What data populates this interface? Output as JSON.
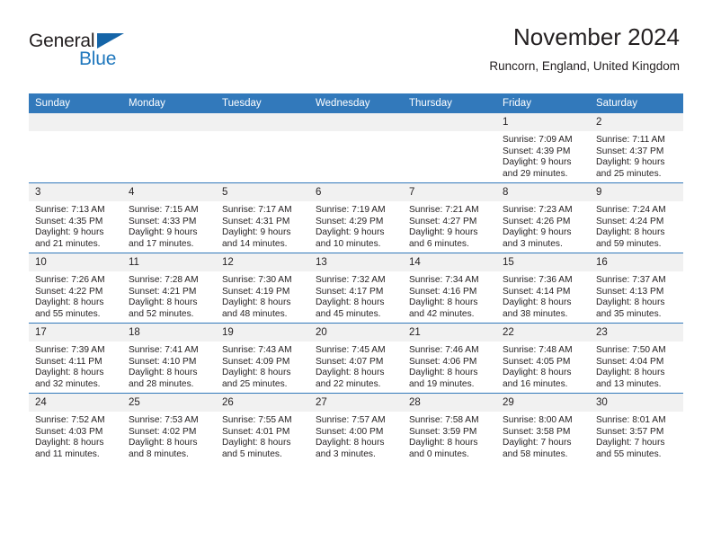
{
  "brand": {
    "name_primary": "General",
    "name_secondary": "Blue",
    "flag_icon": "triangle-flag-icon",
    "accent_color": "#1f77bd"
  },
  "header": {
    "title": "November 2024",
    "subtitle": "Runcorn, England, United Kingdom"
  },
  "theme": {
    "header_row_color": "#3279bb",
    "daynum_band_color": "#f1f1f1",
    "text_color": "#231f20"
  },
  "weekday_headers": [
    "Sunday",
    "Monday",
    "Tuesday",
    "Wednesday",
    "Thursday",
    "Friday",
    "Saturday"
  ],
  "labels": {
    "sunrise_prefix": "Sunrise:",
    "sunset_prefix": "Sunset:",
    "daylight_prefix": "Daylight:"
  },
  "weeks": [
    [
      {
        "day": "",
        "empty": true
      },
      {
        "day": "",
        "empty": true
      },
      {
        "day": "",
        "empty": true
      },
      {
        "day": "",
        "empty": true
      },
      {
        "day": "",
        "empty": true
      },
      {
        "day": "1",
        "sunrise": "Sunrise: 7:09 AM",
        "sunset": "Sunset: 4:39 PM",
        "daylight_line1": "Daylight: 9 hours",
        "daylight_line2": "and 29 minutes."
      },
      {
        "day": "2",
        "sunrise": "Sunrise: 7:11 AM",
        "sunset": "Sunset: 4:37 PM",
        "daylight_line1": "Daylight: 9 hours",
        "daylight_line2": "and 25 minutes."
      }
    ],
    [
      {
        "day": "3",
        "sunrise": "Sunrise: 7:13 AM",
        "sunset": "Sunset: 4:35 PM",
        "daylight_line1": "Daylight: 9 hours",
        "daylight_line2": "and 21 minutes."
      },
      {
        "day": "4",
        "sunrise": "Sunrise: 7:15 AM",
        "sunset": "Sunset: 4:33 PM",
        "daylight_line1": "Daylight: 9 hours",
        "daylight_line2": "and 17 minutes."
      },
      {
        "day": "5",
        "sunrise": "Sunrise: 7:17 AM",
        "sunset": "Sunset: 4:31 PM",
        "daylight_line1": "Daylight: 9 hours",
        "daylight_line2": "and 14 minutes."
      },
      {
        "day": "6",
        "sunrise": "Sunrise: 7:19 AM",
        "sunset": "Sunset: 4:29 PM",
        "daylight_line1": "Daylight: 9 hours",
        "daylight_line2": "and 10 minutes."
      },
      {
        "day": "7",
        "sunrise": "Sunrise: 7:21 AM",
        "sunset": "Sunset: 4:27 PM",
        "daylight_line1": "Daylight: 9 hours",
        "daylight_line2": "and 6 minutes."
      },
      {
        "day": "8",
        "sunrise": "Sunrise: 7:23 AM",
        "sunset": "Sunset: 4:26 PM",
        "daylight_line1": "Daylight: 9 hours",
        "daylight_line2": "and 3 minutes."
      },
      {
        "day": "9",
        "sunrise": "Sunrise: 7:24 AM",
        "sunset": "Sunset: 4:24 PM",
        "daylight_line1": "Daylight: 8 hours",
        "daylight_line2": "and 59 minutes."
      }
    ],
    [
      {
        "day": "10",
        "sunrise": "Sunrise: 7:26 AM",
        "sunset": "Sunset: 4:22 PM",
        "daylight_line1": "Daylight: 8 hours",
        "daylight_line2": "and 55 minutes."
      },
      {
        "day": "11",
        "sunrise": "Sunrise: 7:28 AM",
        "sunset": "Sunset: 4:21 PM",
        "daylight_line1": "Daylight: 8 hours",
        "daylight_line2": "and 52 minutes."
      },
      {
        "day": "12",
        "sunrise": "Sunrise: 7:30 AM",
        "sunset": "Sunset: 4:19 PM",
        "daylight_line1": "Daylight: 8 hours",
        "daylight_line2": "and 48 minutes."
      },
      {
        "day": "13",
        "sunrise": "Sunrise: 7:32 AM",
        "sunset": "Sunset: 4:17 PM",
        "daylight_line1": "Daylight: 8 hours",
        "daylight_line2": "and 45 minutes."
      },
      {
        "day": "14",
        "sunrise": "Sunrise: 7:34 AM",
        "sunset": "Sunset: 4:16 PM",
        "daylight_line1": "Daylight: 8 hours",
        "daylight_line2": "and 42 minutes."
      },
      {
        "day": "15",
        "sunrise": "Sunrise: 7:36 AM",
        "sunset": "Sunset: 4:14 PM",
        "daylight_line1": "Daylight: 8 hours",
        "daylight_line2": "and 38 minutes."
      },
      {
        "day": "16",
        "sunrise": "Sunrise: 7:37 AM",
        "sunset": "Sunset: 4:13 PM",
        "daylight_line1": "Daylight: 8 hours",
        "daylight_line2": "and 35 minutes."
      }
    ],
    [
      {
        "day": "17",
        "sunrise": "Sunrise: 7:39 AM",
        "sunset": "Sunset: 4:11 PM",
        "daylight_line1": "Daylight: 8 hours",
        "daylight_line2": "and 32 minutes."
      },
      {
        "day": "18",
        "sunrise": "Sunrise: 7:41 AM",
        "sunset": "Sunset: 4:10 PM",
        "daylight_line1": "Daylight: 8 hours",
        "daylight_line2": "and 28 minutes."
      },
      {
        "day": "19",
        "sunrise": "Sunrise: 7:43 AM",
        "sunset": "Sunset: 4:09 PM",
        "daylight_line1": "Daylight: 8 hours",
        "daylight_line2": "and 25 minutes."
      },
      {
        "day": "20",
        "sunrise": "Sunrise: 7:45 AM",
        "sunset": "Sunset: 4:07 PM",
        "daylight_line1": "Daylight: 8 hours",
        "daylight_line2": "and 22 minutes."
      },
      {
        "day": "21",
        "sunrise": "Sunrise: 7:46 AM",
        "sunset": "Sunset: 4:06 PM",
        "daylight_line1": "Daylight: 8 hours",
        "daylight_line2": "and 19 minutes."
      },
      {
        "day": "22",
        "sunrise": "Sunrise: 7:48 AM",
        "sunset": "Sunset: 4:05 PM",
        "daylight_line1": "Daylight: 8 hours",
        "daylight_line2": "and 16 minutes."
      },
      {
        "day": "23",
        "sunrise": "Sunrise: 7:50 AM",
        "sunset": "Sunset: 4:04 PM",
        "daylight_line1": "Daylight: 8 hours",
        "daylight_line2": "and 13 minutes."
      }
    ],
    [
      {
        "day": "24",
        "sunrise": "Sunrise: 7:52 AM",
        "sunset": "Sunset: 4:03 PM",
        "daylight_line1": "Daylight: 8 hours",
        "daylight_line2": "and 11 minutes."
      },
      {
        "day": "25",
        "sunrise": "Sunrise: 7:53 AM",
        "sunset": "Sunset: 4:02 PM",
        "daylight_line1": "Daylight: 8 hours",
        "daylight_line2": "and 8 minutes."
      },
      {
        "day": "26",
        "sunrise": "Sunrise: 7:55 AM",
        "sunset": "Sunset: 4:01 PM",
        "daylight_line1": "Daylight: 8 hours",
        "daylight_line2": "and 5 minutes."
      },
      {
        "day": "27",
        "sunrise": "Sunrise: 7:57 AM",
        "sunset": "Sunset: 4:00 PM",
        "daylight_line1": "Daylight: 8 hours",
        "daylight_line2": "and 3 minutes."
      },
      {
        "day": "28",
        "sunrise": "Sunrise: 7:58 AM",
        "sunset": "Sunset: 3:59 PM",
        "daylight_line1": "Daylight: 8 hours",
        "daylight_line2": "and 0 minutes."
      },
      {
        "day": "29",
        "sunrise": "Sunrise: 8:00 AM",
        "sunset": "Sunset: 3:58 PM",
        "daylight_line1": "Daylight: 7 hours",
        "daylight_line2": "and 58 minutes."
      },
      {
        "day": "30",
        "sunrise": "Sunrise: 8:01 AM",
        "sunset": "Sunset: 3:57 PM",
        "daylight_line1": "Daylight: 7 hours",
        "daylight_line2": "and 55 minutes."
      }
    ]
  ]
}
